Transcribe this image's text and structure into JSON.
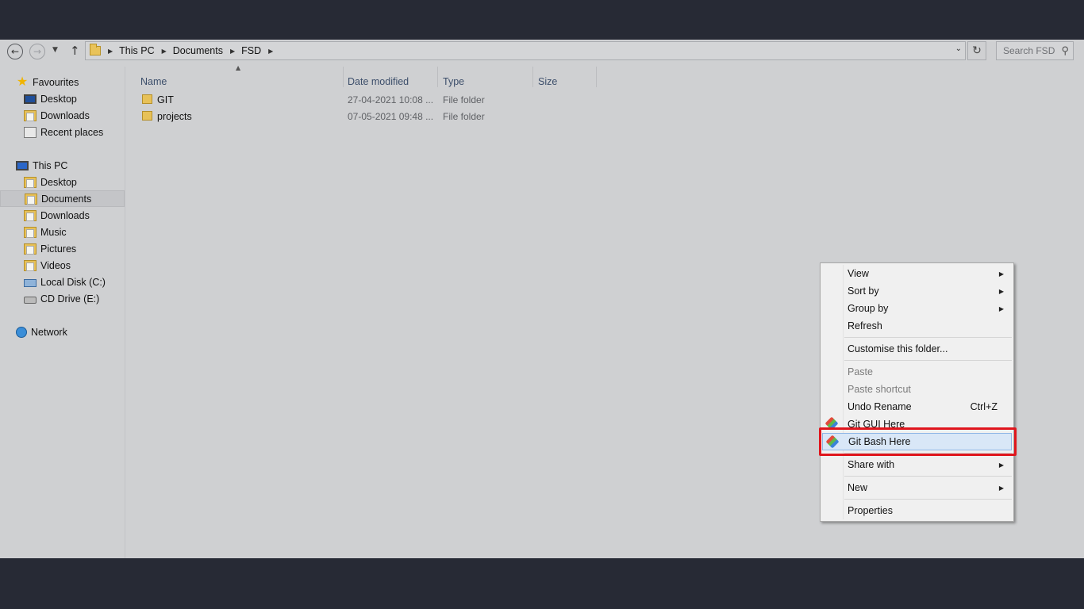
{
  "breadcrumb": [
    "This PC",
    "Documents",
    "FSD"
  ],
  "search": {
    "placeholder": "Search FSD"
  },
  "navpane": {
    "favourites": {
      "label": "Favourites",
      "items": [
        "Desktop",
        "Downloads",
        "Recent places"
      ]
    },
    "this_pc": {
      "label": "This PC",
      "items": [
        "Desktop",
        "Documents",
        "Downloads",
        "Music",
        "Pictures",
        "Videos",
        "Local Disk (C:)",
        "CD Drive (E:)"
      ],
      "selected": "Documents"
    },
    "network": {
      "label": "Network"
    }
  },
  "columns": {
    "name": "Name",
    "date": "Date modified",
    "type": "Type",
    "size": "Size"
  },
  "files": [
    {
      "name": "GIT",
      "date": "27-04-2021 10:08 ...",
      "type": "File folder"
    },
    {
      "name": "projects",
      "date": "07-05-2021 09:48 ...",
      "type": "File folder"
    }
  ],
  "context_menu": {
    "view": "View",
    "sort_by": "Sort by",
    "group_by": "Group by",
    "refresh": "Refresh",
    "customise": "Customise this folder...",
    "paste": "Paste",
    "paste_shortcut": "Paste shortcut",
    "undo_rename": "Undo Rename",
    "undo_accel": "Ctrl+Z",
    "git_gui": "Git GUI Here",
    "git_bash": "Git Bash Here",
    "share_with": "Share with",
    "new": "New",
    "properties": "Properties"
  },
  "colors": {
    "highlight_callout": "#e0161d",
    "menu_hover": "#d9e7f7"
  }
}
